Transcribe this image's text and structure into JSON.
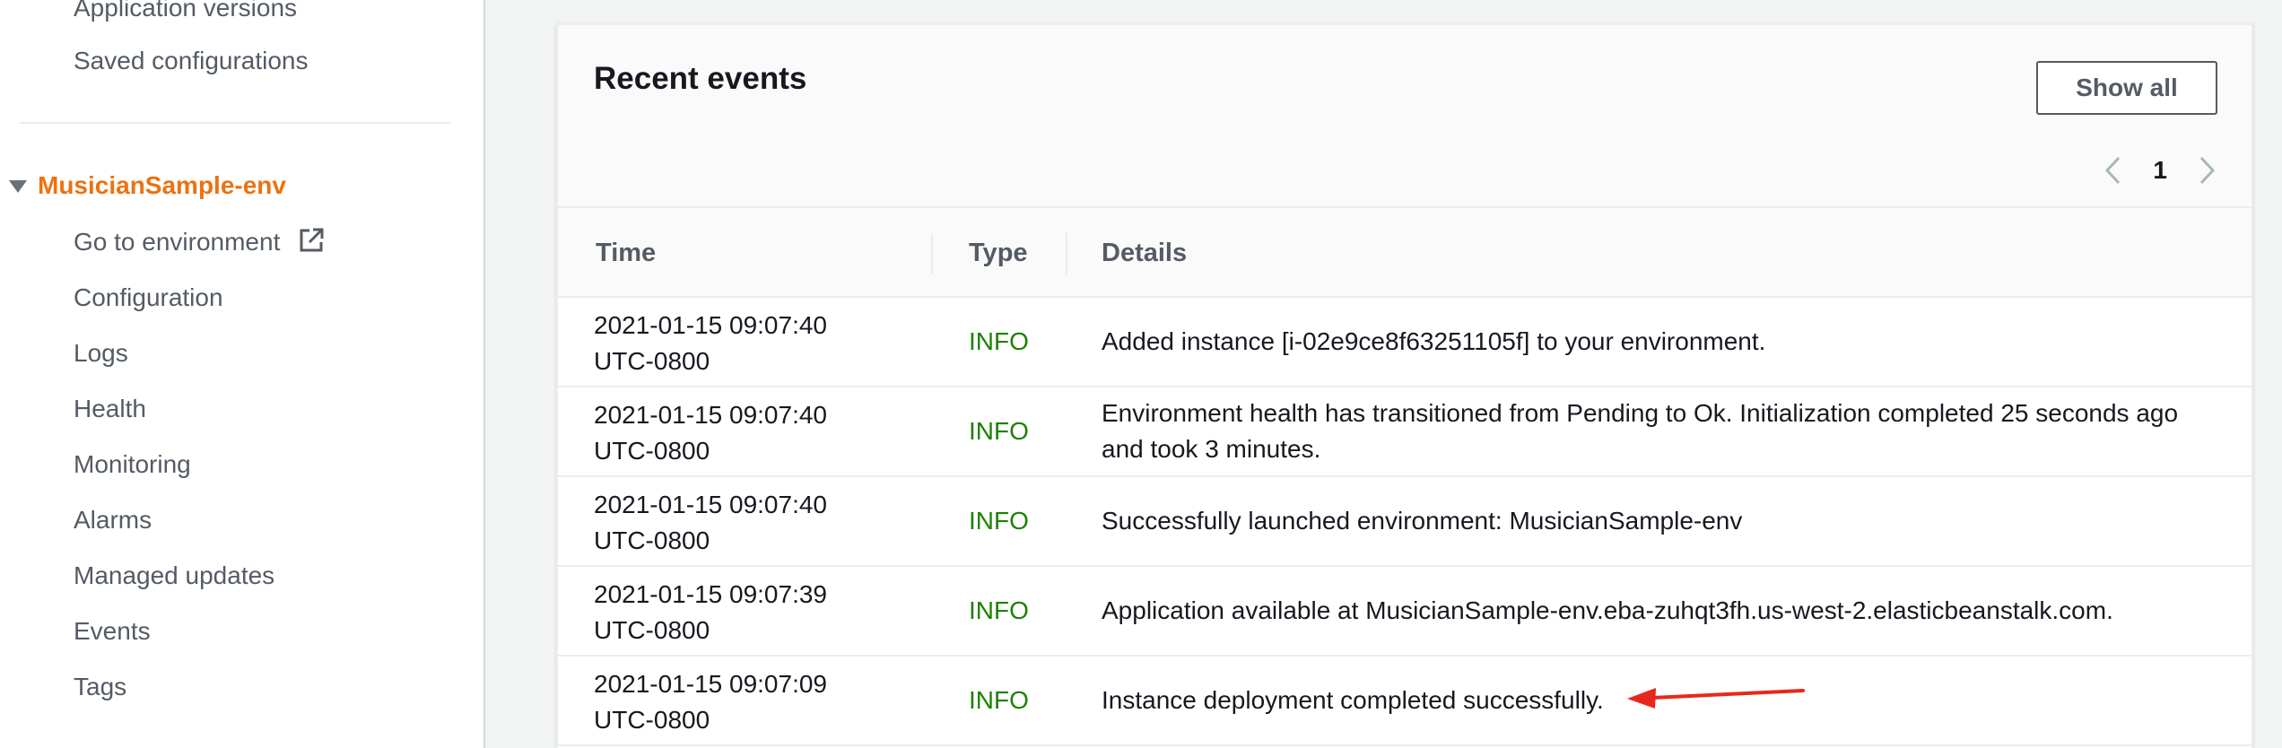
{
  "sidebar": {
    "top_items": [
      "Application versions",
      "Saved configurations"
    ],
    "environment": {
      "name": "MusicianSample-env",
      "items": [
        "Go to environment",
        "Configuration",
        "Logs",
        "Health",
        "Monitoring",
        "Alarms",
        "Managed updates",
        "Events",
        "Tags"
      ]
    }
  },
  "panel": {
    "title": "Recent events",
    "show_all_label": "Show all",
    "pagination": {
      "current_page": "1"
    }
  },
  "table": {
    "headers": {
      "time": "Time",
      "type": "Type",
      "details": "Details"
    },
    "rows": [
      {
        "time_date": "2021-01-15 09:07:40",
        "time_zone": "UTC-0800",
        "type": "INFO",
        "details": "Added instance [i-02e9ce8f63251105f] to your environment."
      },
      {
        "time_date": "2021-01-15 09:07:40",
        "time_zone": "UTC-0800",
        "type": "INFO",
        "details": "Environment health has transitioned from Pending to Ok. Initialization completed 25 seconds ago and took 3 minutes."
      },
      {
        "time_date": "2021-01-15 09:07:40",
        "time_zone": "UTC-0800",
        "type": "INFO",
        "details": "Successfully launched environment: MusicianSample-env"
      },
      {
        "time_date": "2021-01-15 09:07:39",
        "time_zone": "UTC-0800",
        "type": "INFO",
        "details": "Application available at MusicianSample-env.eba-zuhqt3fh.us-west-2.elasticbeanstalk.com."
      },
      {
        "time_date": "2021-01-15 09:07:09",
        "time_zone": "UTC-0800",
        "type": "INFO",
        "details": "Instance deployment completed successfully."
      }
    ]
  },
  "colors": {
    "accent": "#ec7211",
    "info": "#1d8102",
    "annotation_arrow": "#e8271c"
  },
  "icons": [
    "external-link-icon",
    "caret-down-icon",
    "chevron-left-icon",
    "chevron-right-icon",
    "arrow-annotation-icon"
  ]
}
